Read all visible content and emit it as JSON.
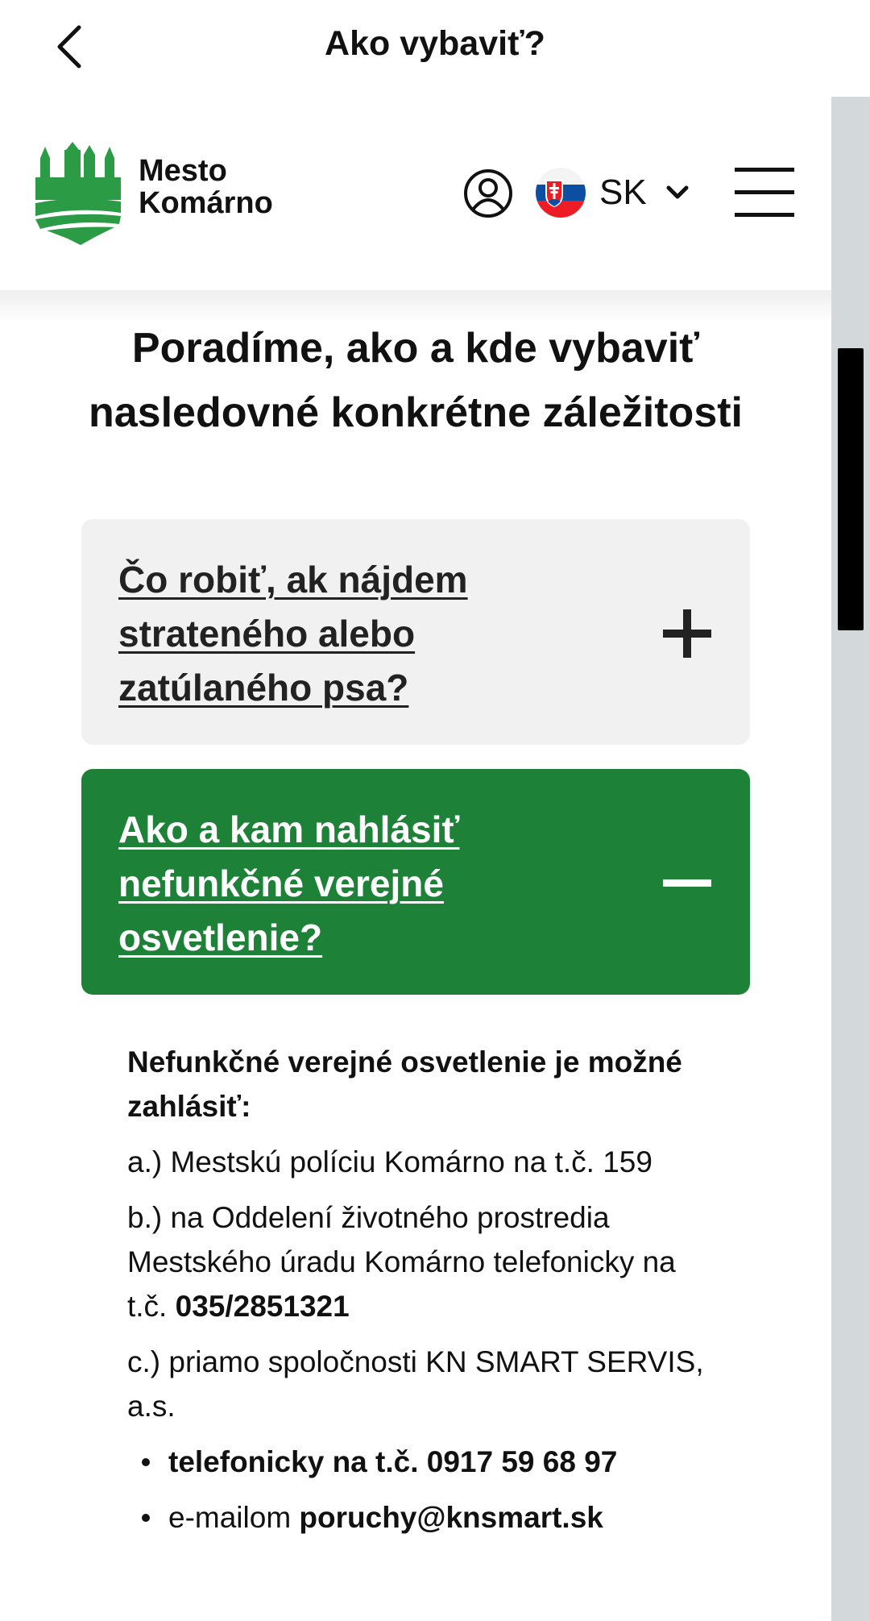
{
  "topbar": {
    "title": "Ako vybaviť?"
  },
  "header": {
    "logo_line1": "Mesto",
    "logo_line2": "Komárno",
    "language": "SK"
  },
  "heading": "Poradíme, ako a kde vybaviť nasledovné konkrétne záležitosti",
  "accordion": [
    {
      "title": "Čo robiť, ak nájdem strateného alebo zatúlaného psa?",
      "state": "collapsed",
      "toggle_icon": "plus-icon"
    },
    {
      "title": "Ako a kam nahlásiť nefunkčné verejné osvetlenie?",
      "state": "expanded",
      "toggle_icon": "minus-icon"
    }
  ],
  "content": {
    "lead": "Nefunkčné verejné osvetlenie je možné zahlásiť:",
    "item_a": "a.) Mestskú políciu Komárno na t.č. 159",
    "item_b_text": "b.) na Oddelení životného prostredia Mestského úradu Komárno telefonicky na t.č. ",
    "item_b_phone": "035/2851321",
    "item_c": "c.) priamo spoločnosti KN SMART SERVIS, a.s.",
    "bullet_phone": "telefonicky na t.č. 0917 59 68 97",
    "bullet_email_prefix": "e-mailom ",
    "bullet_email": "poruchy@knsmart.sk"
  },
  "colors": {
    "brand_green": "#1e8138",
    "logo_green": "#2c9b46",
    "accordion_grey": "#f1f1f1",
    "scroll_track": "#d3d8da"
  }
}
